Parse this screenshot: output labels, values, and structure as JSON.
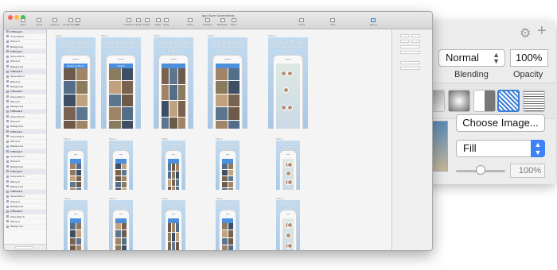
{
  "window": {
    "title": "App Store Screenshots",
    "toolbar": [
      {
        "label": "Insert",
        "icon": "insert-icon"
      },
      {
        "label": "Group",
        "icon": "group-icon"
      },
      {
        "label": "Ungroup",
        "icon": "ungroup-icon"
      },
      {
        "label": "Create Symbol",
        "icon": "symbol-icon"
      },
      {
        "label": "Edit",
        "icon": "edit-icon"
      },
      {
        "label": "Transform",
        "icon": "transform-icon"
      },
      {
        "label": "Rotate",
        "icon": "rotate-icon"
      },
      {
        "label": "Flatten",
        "icon": "flatten-icon"
      },
      {
        "label": "Mask",
        "icon": "mask-icon"
      },
      {
        "label": "Scale",
        "icon": "scale-icon"
      },
      {
        "label": "Union",
        "icon": "union-icon"
      },
      {
        "label": "Forward",
        "icon": "forward-icon"
      },
      {
        "label": "Backward",
        "icon": "backward-icon"
      },
      {
        "label": "Mirror",
        "icon": "mirror-icon"
      },
      {
        "label": "Cloud",
        "icon": "cloud-icon"
      },
      {
        "label": "View",
        "icon": "view-icon"
      },
      {
        "label": "Export",
        "icon": "export-icon"
      }
    ]
  },
  "layers": [
    {
      "name": "iPhone 6",
      "group": true
    },
    {
      "name": "Screenshot 1",
      "group": false
    },
    {
      "name": "iPhone 6",
      "group": false
    },
    {
      "name": "Background",
      "group": false
    },
    {
      "name": "iPhone 6",
      "group": true
    },
    {
      "name": "Screenshot 2",
      "group": false
    },
    {
      "name": "iPhone 6",
      "group": false
    },
    {
      "name": "Background",
      "group": false
    },
    {
      "name": "iPhone 6",
      "group": true
    },
    {
      "name": "Screenshot 3",
      "group": false
    },
    {
      "name": "iPhone 6",
      "group": false
    },
    {
      "name": "Background",
      "group": false
    },
    {
      "name": "iPhone 6",
      "group": true
    },
    {
      "name": "Screenshot 4",
      "group": false
    },
    {
      "name": "iPhone 6",
      "group": false
    },
    {
      "name": "Background",
      "group": false
    },
    {
      "name": "iPhone 6",
      "group": true
    },
    {
      "name": "Screenshot 5",
      "group": false
    },
    {
      "name": "iPhone 6",
      "group": false
    },
    {
      "name": "Background",
      "group": false
    },
    {
      "name": "iPhone 6",
      "group": true
    },
    {
      "name": "Screenshot 1",
      "group": false
    },
    {
      "name": "iPhone 6",
      "group": false
    },
    {
      "name": "Background",
      "group": false
    },
    {
      "name": "iPhone 6",
      "group": true
    },
    {
      "name": "Screenshot 2",
      "group": false
    },
    {
      "name": "iPhone 6",
      "group": false
    },
    {
      "name": "Background",
      "group": false
    },
    {
      "name": "iPhone 6",
      "group": true
    },
    {
      "name": "Screenshot 3",
      "group": false
    },
    {
      "name": "iPhone 6",
      "group": false
    },
    {
      "name": "Background",
      "group": false
    },
    {
      "name": "iPhone 6",
      "group": true
    },
    {
      "name": "Screenshot 4",
      "group": false
    },
    {
      "name": "iPhone 6",
      "group": false
    },
    {
      "name": "Background",
      "group": false
    },
    {
      "name": "iPhone 6",
      "group": true
    },
    {
      "name": "Screenshot 5",
      "group": false
    },
    {
      "name": "iPhone 6",
      "group": false
    },
    {
      "name": "Background",
      "group": false
    }
  ],
  "artboards": {
    "captions": [
      "This is the first thing you'll say about your product",
      "This is the second thing you'll say about your product",
      "This is the third thing you'll say about your product",
      "This is the fourth thing you'll say about your product",
      "This is the fifth thing you'll say about your product"
    ],
    "app_names": [
      "Photos & Videos",
      "Cluster",
      "",
      "",
      ""
    ]
  },
  "inspector": {
    "blending_value": "Normal",
    "blending_label": "Blending",
    "opacity_value": "100%",
    "opacity_label": "Opacity",
    "choose_image_label": "Choose Image...",
    "fill_mode_value": "Fill",
    "image_opacity_value": "100%",
    "image_opacity_fraction": 0.5
  },
  "colors": {
    "accent_blue": "#3d83f7",
    "artboard_bg": "#b6d2ec",
    "header_blue": "#4c8fdc"
  }
}
